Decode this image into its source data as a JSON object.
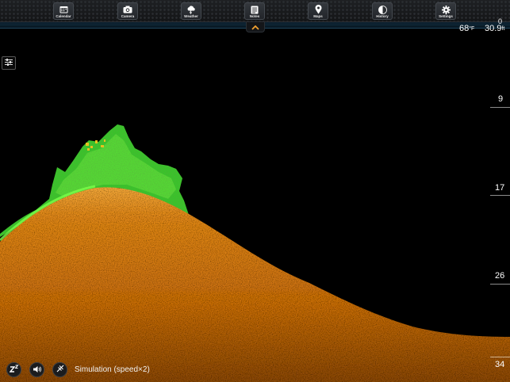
{
  "toolbar": {
    "items": [
      {
        "label": "Calendar",
        "icon": "calendar-icon"
      },
      {
        "label": "Camera",
        "icon": "camera-icon"
      },
      {
        "label": "Weather",
        "icon": "weather-icon"
      },
      {
        "label": "Notes",
        "icon": "notes-icon"
      },
      {
        "label": "Maps",
        "icon": "map-pin-icon"
      },
      {
        "label": "History",
        "icon": "history-icon"
      },
      {
        "label": "Settings",
        "icon": "gear-icon"
      }
    ]
  },
  "readouts": {
    "temperature_value": "68",
    "temperature_unit": "°F",
    "depth_value": "30.9",
    "depth_unit": "ft"
  },
  "depth_scale": {
    "labels": [
      "0",
      "9",
      "17",
      "26",
      "34"
    ]
  },
  "status": {
    "simulation_label": "Simulation (speed×2)"
  },
  "colors": {
    "bottom": "#e0871a",
    "fish_cloud": "#3fcf2c",
    "background": "#000000"
  }
}
